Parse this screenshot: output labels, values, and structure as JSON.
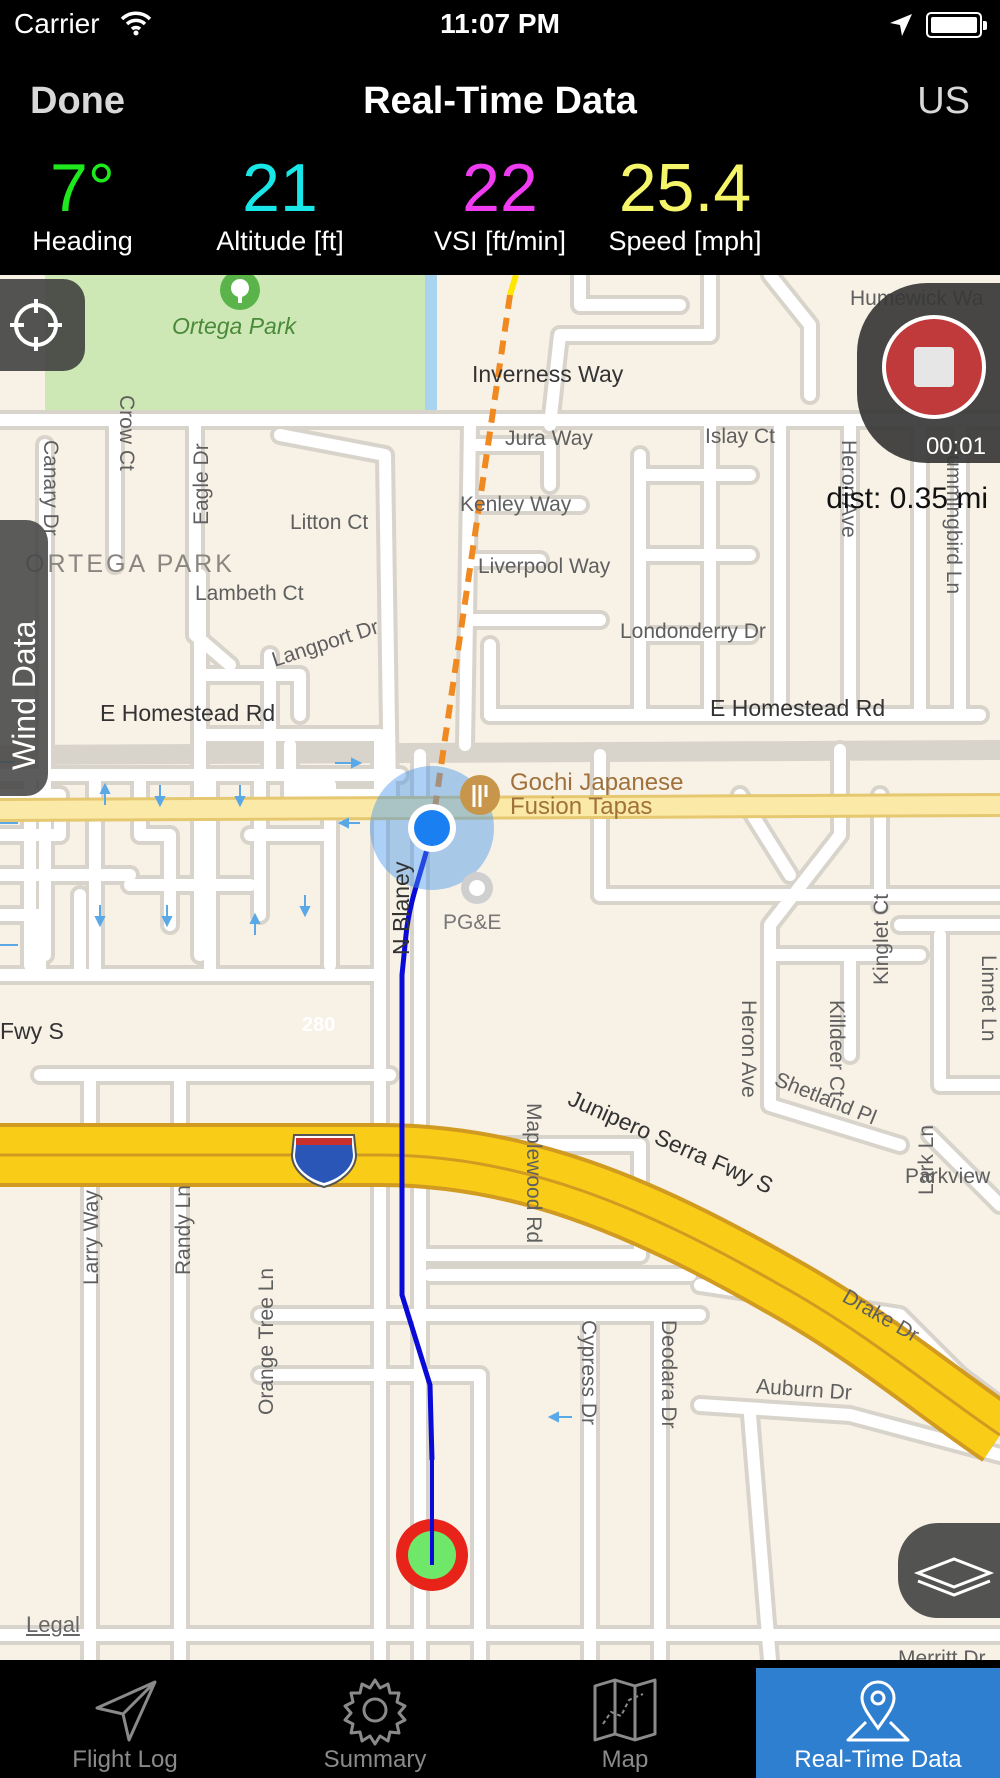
{
  "status_bar": {
    "carrier": "Carrier",
    "time": "11:07 PM"
  },
  "nav": {
    "done_label": "Done",
    "title": "Real-Time Data",
    "units": "US"
  },
  "stats": [
    {
      "value": "7°",
      "label": "Heading",
      "color": "#1ee81e"
    },
    {
      "value": "21",
      "label": "Altitude [ft]",
      "color": "#19e6e6"
    },
    {
      "value": "22",
      "label": "VSI [ft/min]",
      "color": "#f03cf0"
    },
    {
      "value": "25.4",
      "label": "Speed [mph]",
      "color": "#f5f56a"
    }
  ],
  "map": {
    "labels": {
      "ortega_park": "Ortega Park",
      "ortega_park_area": "ORTEGA PARK",
      "inverness": "Inverness Way",
      "jura": "Jura Way",
      "islay": "Islay Ct",
      "kenley": "Kenley Way",
      "litton": "Litton Ct",
      "liverpool": "Liverpool Way",
      "lambeth": "Lambeth Ct",
      "londonderry": "Londonderry Dr",
      "langport": "Langport Dr",
      "homestead_w": "E Homestead Rd",
      "homestead_e": "E Homestead Rd",
      "gochi_1": "Gochi Japanese",
      "gochi_2": "Fusion Tapas",
      "pge": "PG&E",
      "blaney": "N Blaney",
      "fwy_s": "Fwy S",
      "i280": "280",
      "junipero": "Junipero Serra Fwy S",
      "shetland": "Shetland Pl",
      "parkview": "Parkview",
      "maplewood": "Maplewood Rd",
      "drake": "Drake Dr",
      "auburn": "Auburn Dr",
      "crow": "Crow Ct",
      "canary": "Canary Dr",
      "eagle": "Eagle Dr",
      "heron_n": "Heron Ave",
      "heron_s": "Heron Ave",
      "hummingbird": "Hummingbird Ln",
      "humewick": "Humewick Wa",
      "kinglet": "Kinglet Ct",
      "killdeer": "Killdeer Ct",
      "lark": "Lark Ln",
      "larry": "Larry Way",
      "randy": "Randy Ln",
      "orange_tree": "Orange Tree Ln",
      "cypress": "Cypress Dr",
      "deodara": "Deodara Dr",
      "merritt": "Merritt Dr",
      "linnet": "Linnet Ln"
    },
    "recording_time": "00:01",
    "distance": "dist: 0.35 mi",
    "wind_label": "Wind Data",
    "legal": "Legal",
    "track_color": "#0a0ad8",
    "projection_color": "#f08a20"
  },
  "tabs": [
    {
      "label": "Flight Log",
      "icon": "paper-plane-icon",
      "active": false
    },
    {
      "label": "Summary",
      "icon": "gear-icon",
      "active": false
    },
    {
      "label": "Map",
      "icon": "folded-map-icon",
      "active": false
    },
    {
      "label": "Real-Time Data",
      "icon": "location-pin-icon",
      "active": true
    }
  ]
}
